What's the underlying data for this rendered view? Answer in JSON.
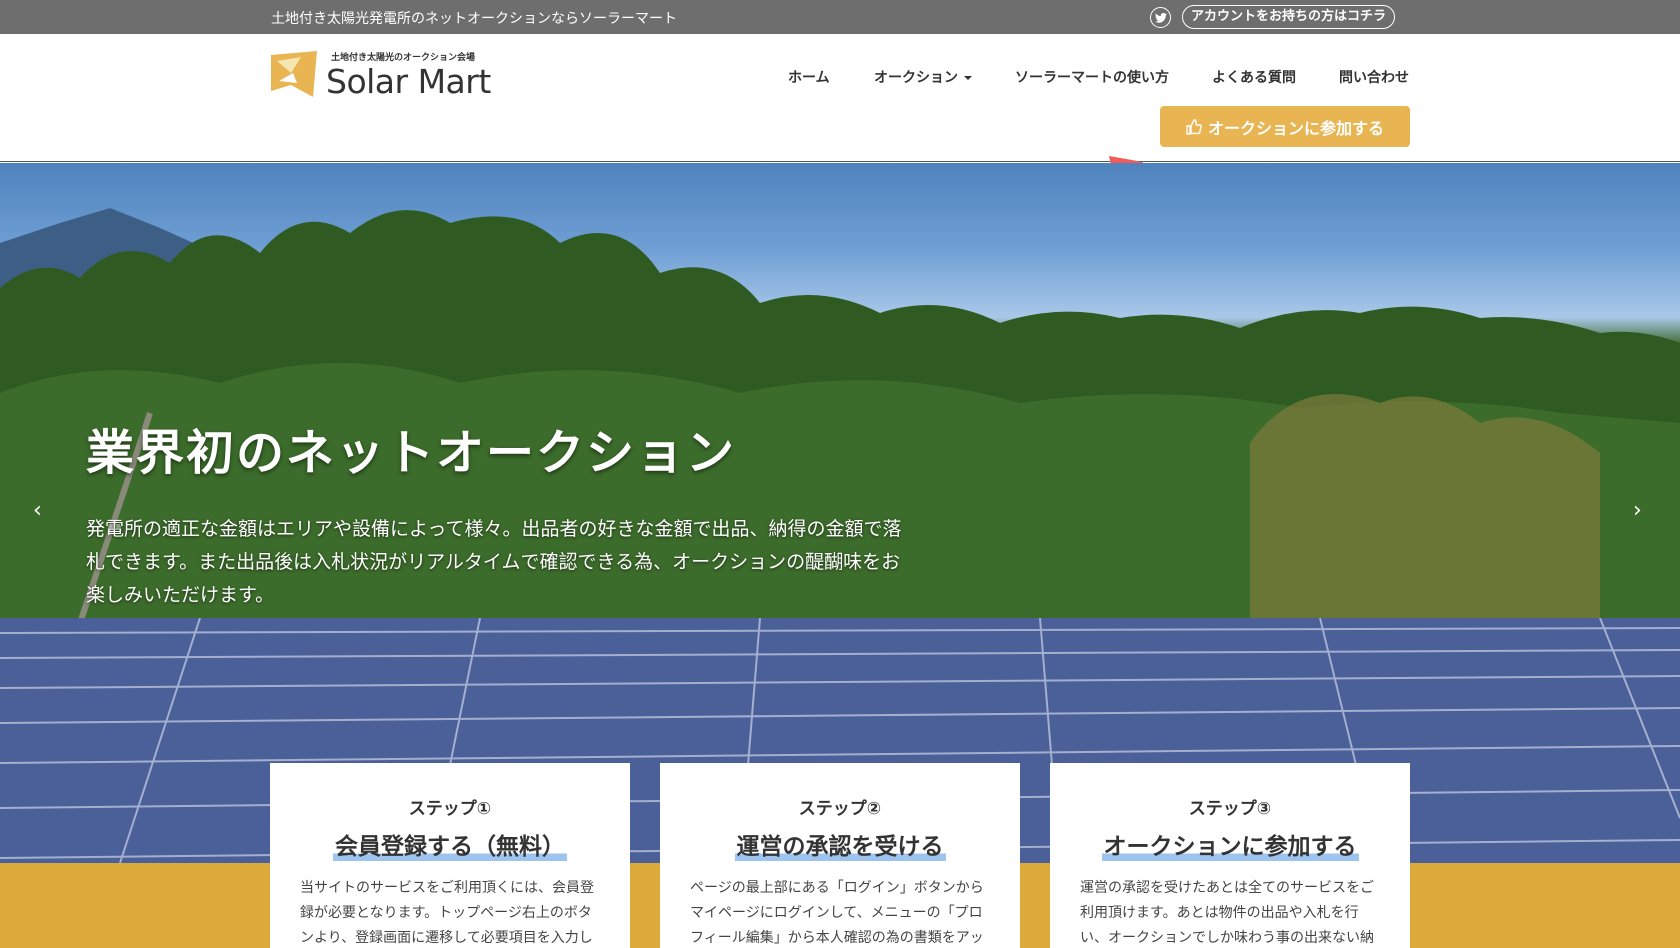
{
  "topbar": {
    "tagline": "土地付き太陽光発電所のネットオークションならソーラーマート",
    "twitter_icon": "twitter-icon",
    "account_link": "アカウントをお持ちの方はコチラ"
  },
  "logo": {
    "subtitle": "土地付き太陽光のオークション会場",
    "name": "Solar Mart",
    "mark_color": "#e9b553"
  },
  "nav": {
    "items": [
      {
        "label": "ホーム"
      },
      {
        "label": "オークション",
        "has_dropdown": true
      },
      {
        "label": "ソーラーマートの使い方"
      },
      {
        "label": "よくある質問"
      },
      {
        "label": "問い合わせ"
      }
    ],
    "cta_label": "オークションに参加する",
    "cta_icon": "thumbs-up-icon",
    "accent_color": "#e9b553"
  },
  "hero": {
    "title": "業界初のネットオークション",
    "lead": "発電所の適正な金額はエリアや設備によって様々。出品者の好きな金額で出品、納得の金額で落札できます。また出品後は入札状況がリアルタイムで確認できる為、オークションの醍醐味をお楽しみいただけます。",
    "prev_icon": "chevron-left-icon",
    "next_icon": "chevron-right-icon",
    "prev_glyph": "‹",
    "next_glyph": "›"
  },
  "steps": [
    {
      "step": "ステップ①",
      "title": "会員登録する（無料）",
      "desc": "当サイトのサービスをご利用頂くには、会員登録が必要となります。トップページ右上のボタンより、登録画面に遷移して必要項目を入力し"
    },
    {
      "step": "ステップ②",
      "title": "運営の承認を受ける",
      "desc": "ページの最上部にある「ログイン」ボタンからマイページにログインして、メニューの「プロフィール編集」から本人確認の為の書類をアッ"
    },
    {
      "step": "ステップ③",
      "title": "オークションに参加する",
      "desc": "運営の承認を受けたあとは全てのサービスをご利用頂けます。あとは物件の出品や入札を行い、オークションでしか味わう事の出来ない納"
    }
  ],
  "colors": {
    "topbar": "#6e6e6e",
    "band": "#dcaa3a",
    "title_underline": "#9dc4ef"
  }
}
